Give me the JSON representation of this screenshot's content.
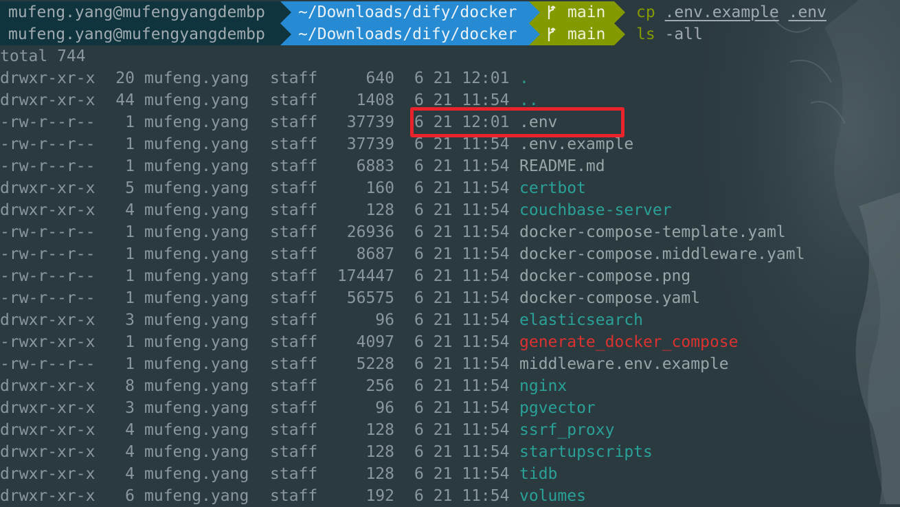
{
  "prompts": [
    {
      "user_host": "mufeng.yang@mufengyangdembp",
      "path": "~/Downloads/dify/docker",
      "branch": "main",
      "command": "cp",
      "args": [
        ".env.example",
        ".env"
      ]
    },
    {
      "user_host": "mufeng.yang@mufengyangdembp",
      "path": "~/Downloads/dify/docker",
      "branch": "main",
      "command": "ls",
      "args": [
        "-all"
      ]
    }
  ],
  "total_line": "total 744",
  "listing": [
    {
      "perm": "drwxr-xr-x",
      "links": "20",
      "owner": "mufeng.yang",
      "group": "staff",
      "size": "640",
      "date": "6 21 12:01",
      "name": ".",
      "type": "dir"
    },
    {
      "perm": "drwxr-xr-x",
      "links": "44",
      "owner": "mufeng.yang",
      "group": "staff",
      "size": "1408",
      "date": "6 21 11:54",
      "name": "..",
      "type": "dir"
    },
    {
      "perm": "-rw-r--r--",
      "links": "1",
      "owner": "mufeng.yang",
      "group": "staff",
      "size": "37739",
      "date": "6 21 12:01",
      "name": ".env",
      "type": "file"
    },
    {
      "perm": "-rw-r--r--",
      "links": "1",
      "owner": "mufeng.yang",
      "group": "staff",
      "size": "37739",
      "date": "6 21 11:54",
      "name": ".env.example",
      "type": "file"
    },
    {
      "perm": "-rw-r--r--",
      "links": "1",
      "owner": "mufeng.yang",
      "group": "staff",
      "size": "6883",
      "date": "6 21 11:54",
      "name": "README.md",
      "type": "file"
    },
    {
      "perm": "drwxr-xr-x",
      "links": "5",
      "owner": "mufeng.yang",
      "group": "staff",
      "size": "160",
      "date": "6 21 11:54",
      "name": "certbot",
      "type": "dir"
    },
    {
      "perm": "drwxr-xr-x",
      "links": "4",
      "owner": "mufeng.yang",
      "group": "staff",
      "size": "128",
      "date": "6 21 11:54",
      "name": "couchbase-server",
      "type": "dir"
    },
    {
      "perm": "-rw-r--r--",
      "links": "1",
      "owner": "mufeng.yang",
      "group": "staff",
      "size": "26936",
      "date": "6 21 11:54",
      "name": "docker-compose-template.yaml",
      "type": "file"
    },
    {
      "perm": "-rw-r--r--",
      "links": "1",
      "owner": "mufeng.yang",
      "group": "staff",
      "size": "8687",
      "date": "6 21 11:54",
      "name": "docker-compose.middleware.yaml",
      "type": "file"
    },
    {
      "perm": "-rw-r--r--",
      "links": "1",
      "owner": "mufeng.yang",
      "group": "staff",
      "size": "174447",
      "date": "6 21 11:54",
      "name": "docker-compose.png",
      "type": "file"
    },
    {
      "perm": "-rw-r--r--",
      "links": "1",
      "owner": "mufeng.yang",
      "group": "staff",
      "size": "56575",
      "date": "6 21 11:54",
      "name": "docker-compose.yaml",
      "type": "file"
    },
    {
      "perm": "drwxr-xr-x",
      "links": "3",
      "owner": "mufeng.yang",
      "group": "staff",
      "size": "96",
      "date": "6 21 11:54",
      "name": "elasticsearch",
      "type": "dir"
    },
    {
      "perm": "-rwxr-xr-x",
      "links": "1",
      "owner": "mufeng.yang",
      "group": "staff",
      "size": "4097",
      "date": "6 21 11:54",
      "name": "generate_docker_compose",
      "type": "exec"
    },
    {
      "perm": "-rw-r--r--",
      "links": "1",
      "owner": "mufeng.yang",
      "group": "staff",
      "size": "5228",
      "date": "6 21 11:54",
      "name": "middleware.env.example",
      "type": "file"
    },
    {
      "perm": "drwxr-xr-x",
      "links": "8",
      "owner": "mufeng.yang",
      "group": "staff",
      "size": "256",
      "date": "6 21 11:54",
      "name": "nginx",
      "type": "dir"
    },
    {
      "perm": "drwxr-xr-x",
      "links": "3",
      "owner": "mufeng.yang",
      "group": "staff",
      "size": "96",
      "date": "6 21 11:54",
      "name": "pgvector",
      "type": "dir"
    },
    {
      "perm": "drwxr-xr-x",
      "links": "4",
      "owner": "mufeng.yang",
      "group": "staff",
      "size": "128",
      "date": "6 21 11:54",
      "name": "ssrf_proxy",
      "type": "dir"
    },
    {
      "perm": "drwxr-xr-x",
      "links": "4",
      "owner": "mufeng.yang",
      "group": "staff",
      "size": "128",
      "date": "6 21 11:54",
      "name": "startupscripts",
      "type": "dir"
    },
    {
      "perm": "drwxr-xr-x",
      "links": "4",
      "owner": "mufeng.yang",
      "group": "staff",
      "size": "128",
      "date": "6 21 11:54",
      "name": "tidb",
      "type": "dir"
    },
    {
      "perm": "drwxr-xr-x",
      "links": "6",
      "owner": "mufeng.yang",
      "group": "staff",
      "size": "192",
      "date": "6 21 11:54",
      "name": "volumes",
      "type": "dir"
    }
  ],
  "highlight": {
    "row_name": ".env",
    "color": "#e8232c"
  },
  "colors": {
    "background": "#2b3a3f",
    "user_segment": "#10343d",
    "path_segment": "#268bd2",
    "git_segment": "#859900",
    "dir": "#2aa198",
    "exec": "#dc322f",
    "file": "#98a6aa"
  }
}
